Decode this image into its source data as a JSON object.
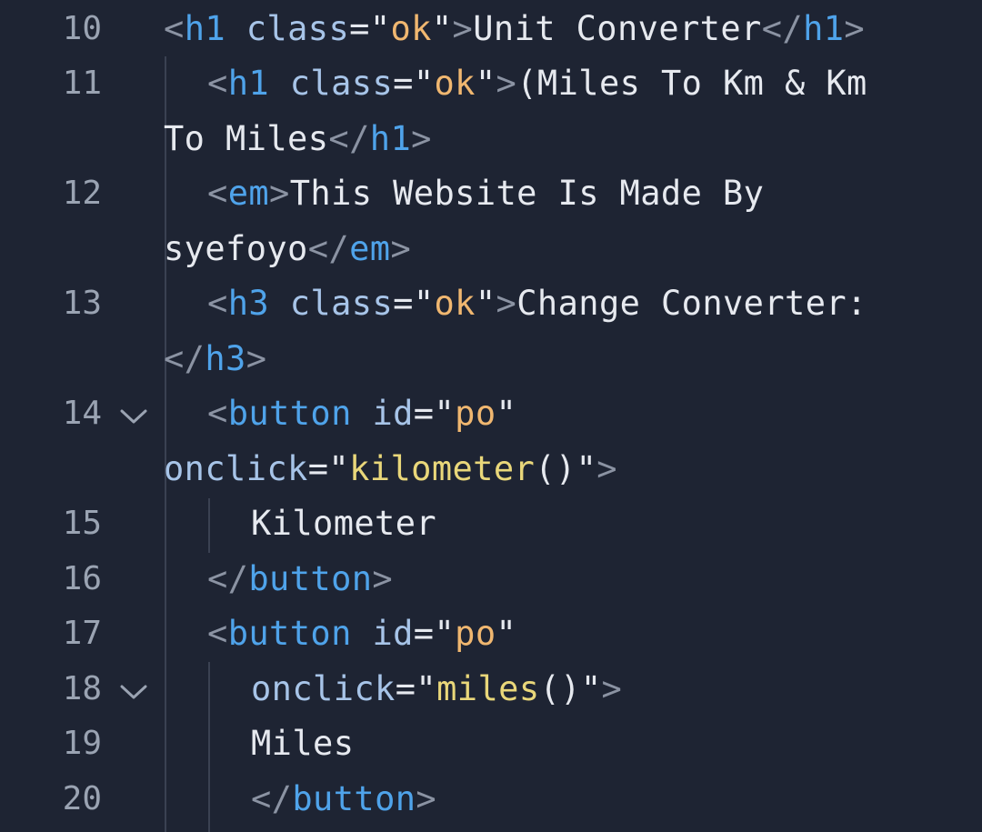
{
  "editor": {
    "line_numbers": [
      "10",
      "11",
      "12",
      "13",
      "14",
      "15",
      "16",
      "17",
      "18",
      "19",
      "20"
    ],
    "fold_markers": {
      "line14": "chevron-down",
      "line18": "chevron-down"
    },
    "colors": {
      "background": "#1e2433",
      "tag": "#4fa3ea",
      "attribute": "#a7c4e8",
      "string": "#f0b770",
      "function": "#e9d77a",
      "punctuation": "#8b93a3",
      "text": "#e6e9ef",
      "line_number": "#9aa3b2"
    },
    "code": {
      "l10": {
        "lt": "<",
        "tag": "h1",
        "attr": "class",
        "eq": "=",
        "q1": "\"",
        "val": "ok",
        "q2": "\"",
        "gt": ">",
        "text": "Unit Converter",
        "close_lt": "</",
        "close_tag": "h1",
        "close_gt": ">"
      },
      "l11a": {
        "lt": "<",
        "tag": "h1",
        "attr": "class",
        "eq": "=",
        "q1": "\"",
        "val": "ok",
        "q2": "\"",
        "gt": ">",
        "text": "(Miles To Km & Km"
      },
      "l11b": {
        "text": "To Miles",
        "close_lt": "</",
        "close_tag": "h1",
        "close_gt": ">"
      },
      "l12a": {
        "lt": "<",
        "tag": "em",
        "gt": ">",
        "text": "This Website Is Made By"
      },
      "l12b": {
        "text": "syefoyo",
        "close_lt": "</",
        "close_tag": "em",
        "close_gt": ">"
      },
      "l13a": {
        "lt": "<",
        "tag": "h3",
        "attr": "class",
        "eq": "=",
        "q1": "\"",
        "val": "ok",
        "q2": "\"",
        "gt": ">",
        "text": "Change Converter:"
      },
      "l13b": {
        "close_lt": "</",
        "close_tag": "h3",
        "close_gt": ">"
      },
      "l14a": {
        "lt": "<",
        "tag": "button",
        "attr": "id",
        "eq": "=",
        "q1": "\"",
        "val": "po",
        "q2": "\""
      },
      "l14b": {
        "attr": "onclick",
        "eq": "=",
        "q1": "\"",
        "fn": "kilometer",
        "parens": "()",
        "q2": "\"",
        "gt": ">"
      },
      "l15": {
        "text": "Kilometer"
      },
      "l16": {
        "close_lt": "</",
        "close_tag": "button",
        "close_gt": ">"
      },
      "l17": {
        "lt": "<",
        "tag": "button",
        "attr": "id",
        "eq": "=",
        "q1": "\"",
        "val": "po",
        "q2": "\""
      },
      "l18": {
        "attr": "onclick",
        "eq": "=",
        "q1": "\"",
        "fn": "miles",
        "parens": "()",
        "q2": "\"",
        "gt": ">"
      },
      "l19": {
        "text": "Miles"
      },
      "l20": {
        "close_lt": "</",
        "close_tag": "button",
        "close_gt": ">"
      }
    }
  }
}
